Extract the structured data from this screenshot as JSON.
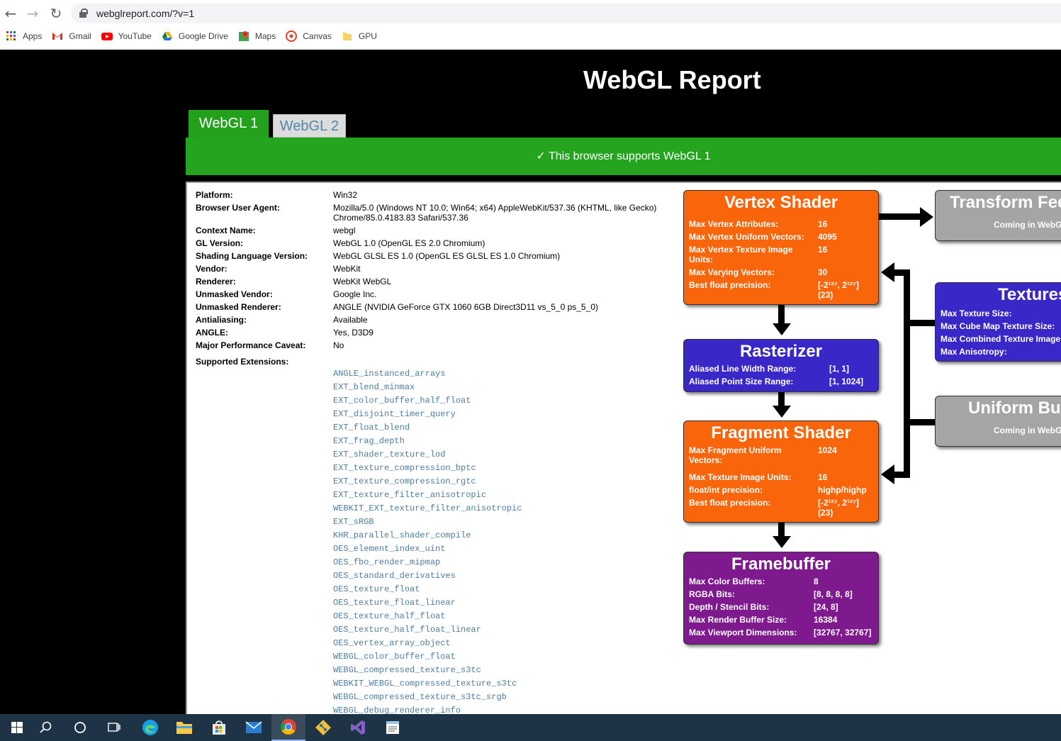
{
  "browser": {
    "url": "webglreport.com/?v=1",
    "bookmarks": [
      {
        "label": "Apps",
        "icon": "apps-grid-icon"
      },
      {
        "label": "Gmail",
        "icon": "gmail-icon"
      },
      {
        "label": "YouTube",
        "icon": "youtube-icon"
      },
      {
        "label": "Google Drive",
        "icon": "google-drive-icon"
      },
      {
        "label": "Maps",
        "icon": "maps-icon"
      },
      {
        "label": "Canvas",
        "icon": "canvas-icon"
      },
      {
        "label": "GPU",
        "icon": "folder-icon"
      }
    ]
  },
  "page": {
    "title": "WebGL Report",
    "tabs": [
      "WebGL 1",
      "WebGL 2"
    ],
    "support_banner": "✓ This browser supports WebGL 1"
  },
  "info": [
    {
      "label": "Platform:",
      "value": "Win32"
    },
    {
      "label": "Browser User Agent:",
      "value": "Mozilla/5.0 (Windows NT 10.0; Win64; x64) AppleWebKit/537.36 (KHTML, like Gecko) Chrome/85.0.4183.83 Safari/537.36"
    },
    {
      "label": "Context Name:",
      "value": "webgl"
    },
    {
      "label": "GL Version:",
      "value": "WebGL 1.0 (OpenGL ES 2.0 Chromium)"
    },
    {
      "label": "Shading Language Version:",
      "value": "WebGL GLSL ES 1.0 (OpenGL ES GLSL ES 1.0 Chromium)"
    },
    {
      "label": "Vendor:",
      "value": "WebKit"
    },
    {
      "label": "Renderer:",
      "value": "WebKit WebGL"
    },
    {
      "label": "Unmasked Vendor:",
      "value": "Google Inc."
    },
    {
      "label": "Unmasked Renderer:",
      "value": "ANGLE (NVIDIA GeForce GTX 1060 6GB Direct3D11 vs_5_0 ps_5_0)"
    },
    {
      "label": "Antialiasing:",
      "value": "Available"
    },
    {
      "label": "ANGLE:",
      "value": "Yes, D3D9"
    },
    {
      "label": "Major Performance Caveat:",
      "value": "No"
    }
  ],
  "extensions_label": "Supported Extensions:",
  "extensions": [
    "ANGLE_instanced_arrays",
    "EXT_blend_minmax",
    "EXT_color_buffer_half_float",
    "EXT_disjoint_timer_query",
    "EXT_float_blend",
    "EXT_frag_depth",
    "EXT_shader_texture_lod",
    "EXT_texture_compression_bptc",
    "EXT_texture_compression_rgtc",
    "EXT_texture_filter_anisotropic",
    "WEBKIT_EXT_texture_filter_anisotropic",
    "EXT_sRGB",
    "KHR_parallel_shader_compile",
    "OES_element_index_uint",
    "OES_fbo_render_mipmap",
    "OES_standard_derivatives",
    "OES_texture_float",
    "OES_texture_float_linear",
    "OES_texture_half_float",
    "OES_texture_half_float_linear",
    "OES_vertex_array_object",
    "WEBGL_color_buffer_float",
    "WEBGL_compressed_texture_s3tc",
    "WEBKIT_WEBGL_compressed_texture_s3tc",
    "WEBGL_compressed_texture_s3tc_srgb",
    "WEBGL_debug_renderer_info"
  ],
  "pipeline": {
    "vertex": {
      "title": "Vertex Shader",
      "rows": [
        {
          "k": "Max Vertex Attributes:",
          "v": "16"
        },
        {
          "k": "Max Vertex Uniform Vectors:",
          "v": "4095"
        },
        {
          "k": "Max Vertex Texture Image Units:",
          "v": "16"
        },
        {
          "k": "Max Varying Vectors:",
          "v": "30"
        },
        {
          "k": "Best float precision:",
          "v": "[-2¹²⁷, 2¹²⁷]",
          "v2": "(23)"
        }
      ]
    },
    "rasterizer": {
      "title": "Rasterizer",
      "rows": [
        {
          "k": "Aliased Line Width Range:",
          "v": "[1, 1]"
        },
        {
          "k": "Aliased Point Size Range:",
          "v": "[1, 1024]"
        }
      ]
    },
    "fragment": {
      "title": "Fragment Shader",
      "rows": [
        {
          "k": "Max Fragment Uniform Vectors:",
          "v": "1024"
        },
        {
          "k": "Max Texture Image Units:",
          "v": "16"
        },
        {
          "k": "float/int precision:",
          "v": "highp/highp"
        },
        {
          "k": "Best float precision:",
          "v": "[-2¹²⁷, 2¹²⁷]",
          "v2": "(23)"
        }
      ]
    },
    "framebuffer": {
      "title": "Framebuffer",
      "rows": [
        {
          "k": "Max Color Buffers:",
          "v": "8"
        },
        {
          "k": "RGBA Bits:",
          "v": "[8, 8, 8, 8]"
        },
        {
          "k": "Depth / Stencil Bits:",
          "v": "[24, 8]"
        },
        {
          "k": "Max Render Buffer Size:",
          "v": "16384"
        },
        {
          "k": "Max Viewport Dimensions:",
          "v": "[32767, 32767]"
        }
      ]
    },
    "transform_feedback": {
      "title": "Transform Fee",
      "note": "Coming in WebGl"
    },
    "textures": {
      "title": "Textures",
      "rows": [
        "Max Texture Size:",
        "Max Cube Map Texture Size:",
        "Max Combined Texture Image",
        "Max Anisotropy:"
      ]
    },
    "uniform_buffers": {
      "title": "Uniform Bu",
      "note": "Coming in WebGl"
    }
  },
  "colors": {
    "green": "#25a420",
    "orange": "#f8650a",
    "blue": "#3a27c8",
    "purple": "#7e1a8d",
    "gray": "#a5a5a5",
    "extension_link": "#4c7ea4"
  },
  "taskbar": [
    "windows-start-icon",
    "search-icon",
    "cortana-icon",
    "task-view-icon",
    "edge-icon",
    "file-explorer-icon",
    "store-icon",
    "mail-icon",
    "chrome-icon",
    "git-icon",
    "visual-studio-icon",
    "notepad-icon"
  ]
}
